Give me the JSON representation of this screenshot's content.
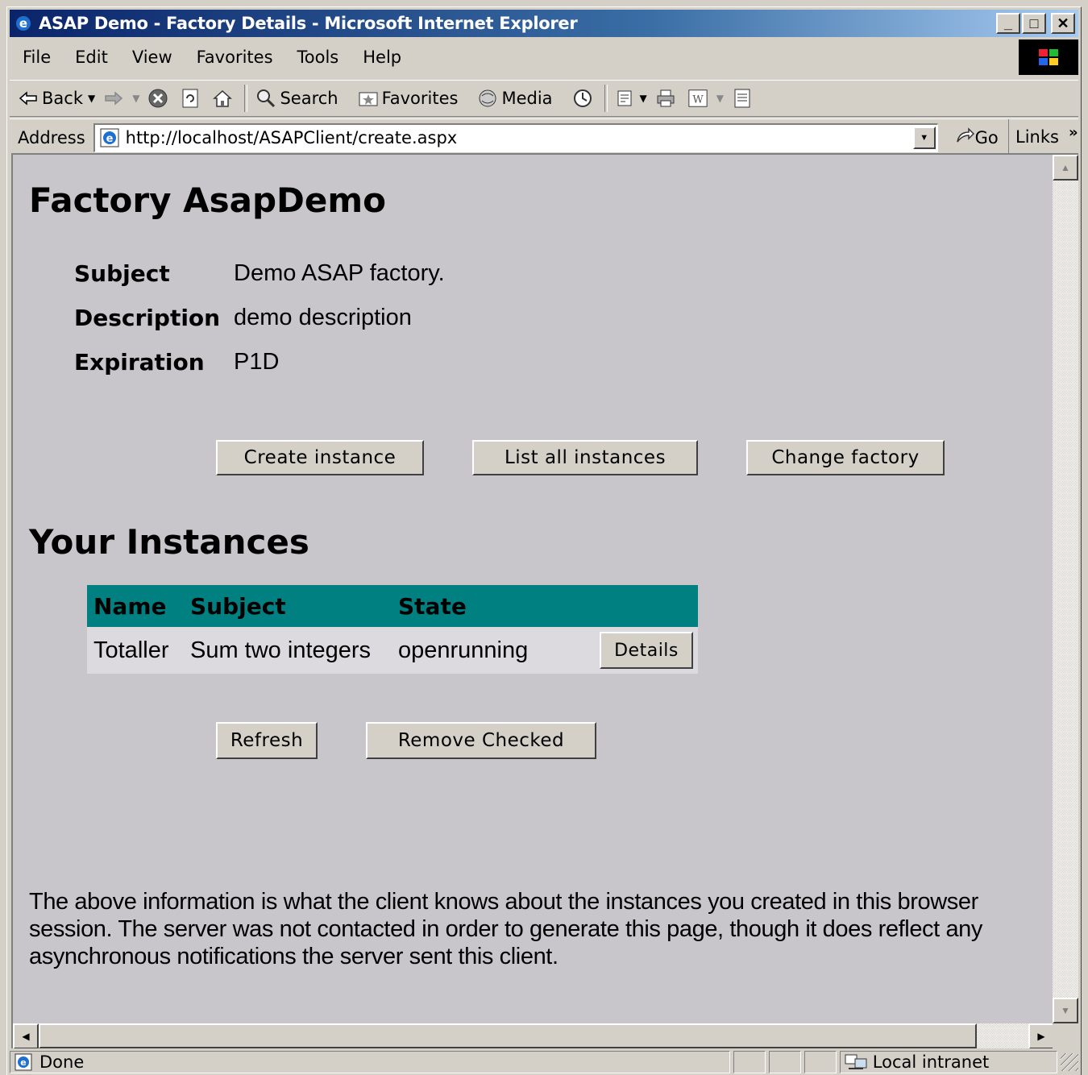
{
  "window": {
    "title": "ASAP Demo - Factory Details - Microsoft Internet Explorer",
    "min_glyph": "_",
    "max_glyph": "□",
    "close_glyph": "✕"
  },
  "menu": {
    "items": [
      {
        "label": "File"
      },
      {
        "label": "Edit"
      },
      {
        "label": "View"
      },
      {
        "label": "Favorites"
      },
      {
        "label": "Tools"
      },
      {
        "label": "Help"
      }
    ]
  },
  "toolbar": {
    "back": "Back",
    "search": "Search",
    "favorites": "Favorites",
    "media": "Media"
  },
  "address": {
    "label": "Address",
    "url": "http://localhost/ASAPClient/create.aspx",
    "go": "Go",
    "links": "Links",
    "links_chevron": "»"
  },
  "page": {
    "title": "Factory AsapDemo",
    "details": [
      {
        "label": "Subject",
        "value": "Demo ASAP factory."
      },
      {
        "label": "Description",
        "value": "demo description"
      },
      {
        "label": "Expiration",
        "value": "P1D"
      }
    ],
    "buttons": {
      "create": "Create instance",
      "list": "List all instances",
      "change": "Change factory"
    },
    "instances_title": "Your Instances",
    "table": {
      "headers": [
        "Name",
        "Subject",
        "State"
      ],
      "rows": [
        {
          "name": "Totaller",
          "subject": "Sum two integers",
          "state": "openrunning",
          "action": "Details"
        }
      ]
    },
    "refresh": "Refresh",
    "remove": "Remove Checked",
    "footer": "The above information is what the client knows about the instances you created in this browser session. The server was not contacted in order to generate this page, though it does reflect any asynchronous notifications the server sent this client."
  },
  "status": {
    "text": "Done",
    "zone": "Local intranet"
  },
  "colors": {
    "title_bar": "#0a246a",
    "table_header": "#008080",
    "content_bg": "#c8c5cb"
  }
}
